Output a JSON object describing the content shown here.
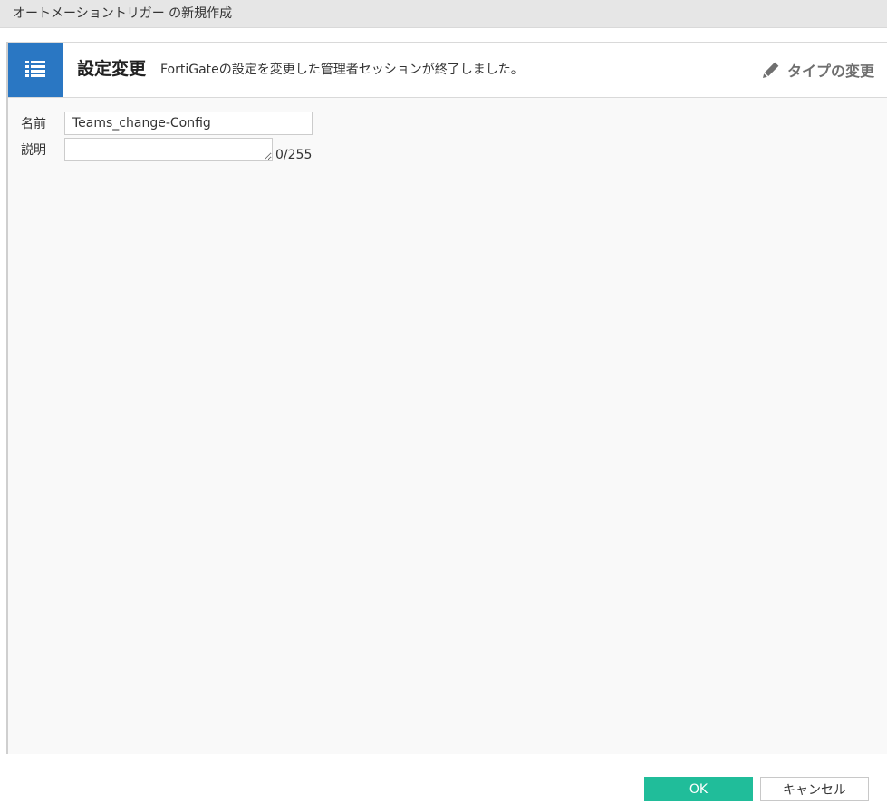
{
  "window": {
    "title": "オートメーショントリガー の新規作成"
  },
  "trigger": {
    "icon": "list-icon",
    "name": "設定変更",
    "description": "FortiGateの設定を変更した管理者セッションが終了しました。",
    "change_type_label": "タイプの変更",
    "change_type_icon": "pencil-icon"
  },
  "form": {
    "name_label": "名前",
    "name_value": "Teams_change-Config",
    "description_label": "説明",
    "description_value": "",
    "char_count": "0/255"
  },
  "buttons": {
    "ok_label": "OK",
    "cancel_label": "キャンセル"
  },
  "colors": {
    "accent_blue": "#2a77c3",
    "ok_green": "#20bd9a",
    "panel_bg": "#f9f9f9",
    "title_bar_bg": "#e6e6e6"
  }
}
